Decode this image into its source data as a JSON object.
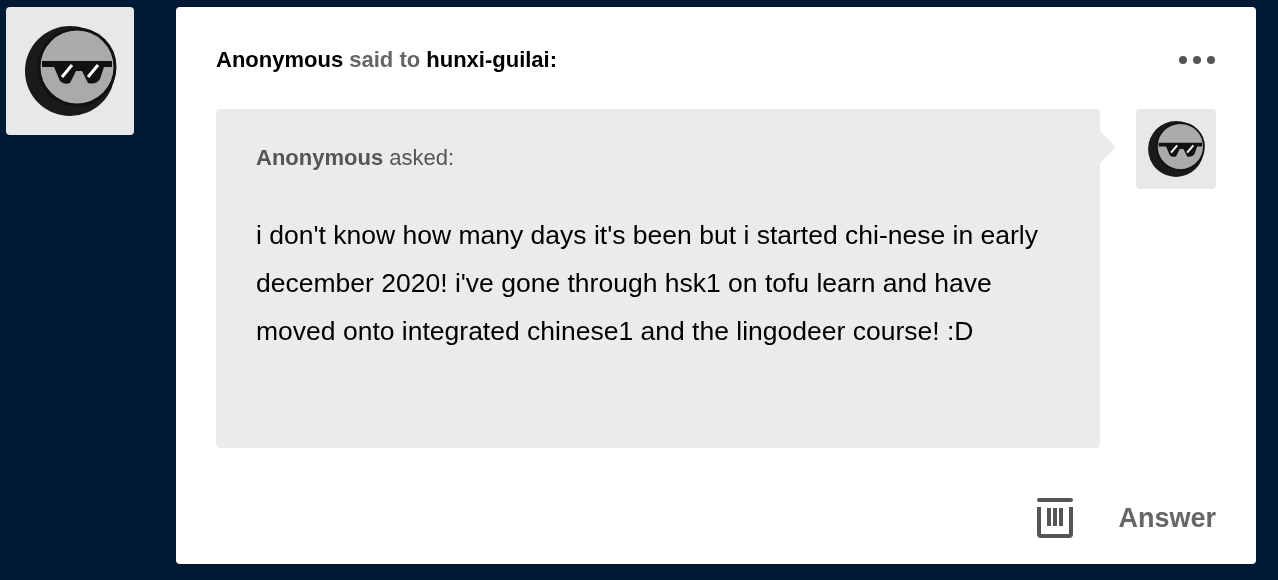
{
  "post": {
    "sender": "Anonymous",
    "verb": "said to",
    "recipient": "hunxi-guilai:"
  },
  "ask": {
    "asker": "Anonymous",
    "verb": "asked:",
    "text": "i don't know how many days it's been but i started chi-nese in early december 2020! i've gone through hsk1 on tofu learn and have moved onto integrated chinese1 and the lingodeer course! :D"
  },
  "footer": {
    "answer_label": "Answer"
  }
}
